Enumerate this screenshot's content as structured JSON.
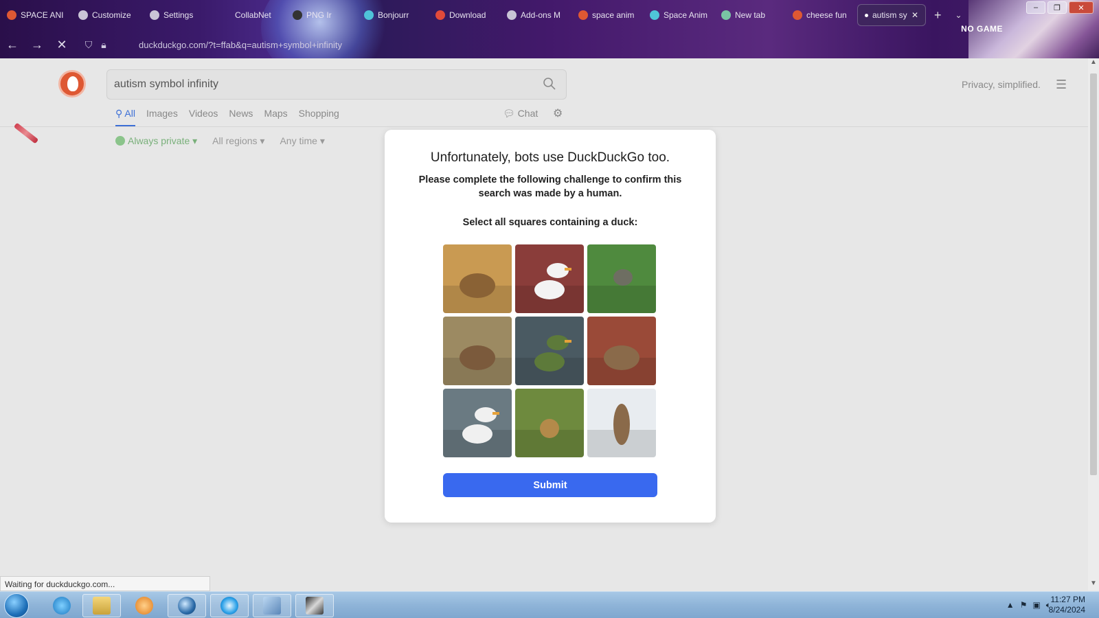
{
  "browser": {
    "tabs": [
      {
        "label": "SPACE ANI",
        "icon": "ddg-favicon-icon",
        "color": "#de5833"
      },
      {
        "label": "Customize",
        "icon": "brush-icon",
        "color": "#c9c4d6"
      },
      {
        "label": "Settings",
        "icon": "gear-icon",
        "color": "#c9c4d6"
      },
      {
        "label": "CollabNet",
        "icon": "none",
        "color": "#000000"
      },
      {
        "label": "PNG Ir",
        "icon": "image-icon",
        "color": "#333333"
      },
      {
        "label": "Bonjourr",
        "icon": "bonjourr-icon",
        "color": "#4fc4d8"
      },
      {
        "label": "Download",
        "icon": "download-site-icon",
        "color": "#e24a3a"
      },
      {
        "label": "Add-ons M",
        "icon": "puzzle-icon",
        "color": "#c9c4d6"
      },
      {
        "label": "space anim",
        "icon": "ddg-favicon-icon",
        "color": "#de5833"
      },
      {
        "label": "Space Anim",
        "icon": "bonjourr-icon",
        "color": "#4fc4d8"
      },
      {
        "label": "New tab",
        "icon": "newtab-icon",
        "color": "#79c4a4"
      },
      {
        "label": "cheese fun",
        "icon": "ddg-favicon-icon",
        "color": "#de5833"
      },
      {
        "label": "autism sy",
        "icon": "loading-dot-icon",
        "color": "#ffffff",
        "active": true
      }
    ],
    "new_tab": "+",
    "url_text": "duckduckgo.com/?t=ffab&q=autism+symbol+infinity",
    "overlay_text": "NO GAME"
  },
  "ddg": {
    "search_value": "autism symbol infinity",
    "tagline": "Privacy, simplified.",
    "tabs": [
      "All",
      "Images",
      "Videos",
      "News",
      "Maps",
      "Shopping"
    ],
    "chat_label": "Chat",
    "filters": {
      "privacy": "Always private ▾",
      "regions": "All regions ▾",
      "time": "Any time ▾"
    }
  },
  "challenge": {
    "title": "Unfortunately, bots use DuckDuckGo too.",
    "subtitle": "Please complete the following challenge to confirm this search was made by a human.",
    "prompt": "Select all squares containing a duck:",
    "submit_label": "Submit",
    "tiles": [
      {
        "subject": "elephant",
        "bg": "#c99a52",
        "fg": "#8a6235"
      },
      {
        "subject": "ducks",
        "bg": "#8a3d3a",
        "fg": "#f3f3f3"
      },
      {
        "subject": "elephant-in-grass",
        "bg": "#4f8a3e",
        "fg": "#6e6e62"
      },
      {
        "subject": "deer",
        "bg": "#9c8a62",
        "fg": "#7b5a3c"
      },
      {
        "subject": "mallard-ducks",
        "bg": "#4a5a62",
        "fg": "#5d7a3a"
      },
      {
        "subject": "monkey",
        "bg": "#9a4a38",
        "fg": "#8a6a4a"
      },
      {
        "subject": "ducks-on-water",
        "bg": "#6a7a82",
        "fg": "#f0f0f0"
      },
      {
        "subject": "lion",
        "bg": "#6e8a3e",
        "fg": "#b48a4a"
      },
      {
        "subject": "giraffe",
        "bg": "#e8ecf0",
        "fg": "#8a6a4a"
      }
    ]
  },
  "status": {
    "text": "Waiting for duckduckgo.com..."
  },
  "clock": {
    "time": "11:27 PM",
    "date": "8/24/2024"
  }
}
